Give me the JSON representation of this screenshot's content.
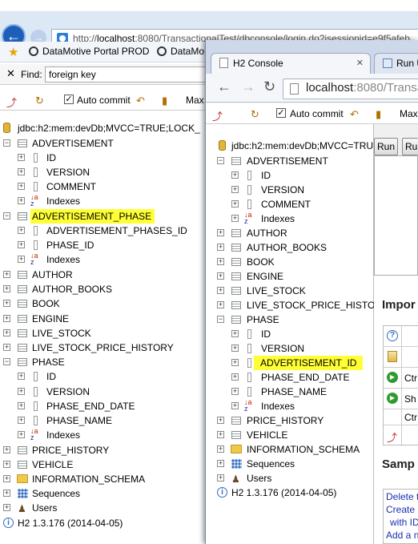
{
  "ie": {
    "url_prefix": "http://",
    "url_host": "localhost",
    "url_rest": ":8080/TransactionalTest/dbconsole/login.do?jsessionid=e9f5afeb",
    "favorites": [
      "DataMotive Portal PROD",
      "DataMo"
    ],
    "find_label": "Find:",
    "find_value": "foreign key",
    "auto_commit": "Auto commit",
    "max_label": "Max",
    "jdbc": "jdbc:h2:mem:devDb;MVCC=TRUE;LOCK_",
    "tree": {
      "advertisement": "ADVERTISEMENT",
      "id": "ID",
      "version": "VERSION",
      "comment": "COMMENT",
      "indexes": "Indexes",
      "advertisement_phase": "ADVERTISEMENT_PHASE",
      "advertisement_phases_id": "ADVERTISEMENT_PHASES_ID",
      "phase_id": "PHASE_ID",
      "author": "AUTHOR",
      "author_books": "AUTHOR_BOOKS",
      "book": "BOOK",
      "engine": "ENGINE",
      "live_stock": "LIVE_STOCK",
      "live_stock_price_history": "LIVE_STOCK_PRICE_HISTORY",
      "phase": "PHASE",
      "phase_end_date": "PHASE_END_DATE",
      "phase_name": "PHASE_NAME",
      "price_history": "PRICE_HISTORY",
      "vehicle": "VEHICLE",
      "information_schema": "INFORMATION_SCHEMA",
      "sequences": "Sequences",
      "users": "Users",
      "version_info": "H2 1.3.176 (2014-04-05)"
    }
  },
  "chrome": {
    "tab1": "H2 Console",
    "tab2": "Run U",
    "url_host": "localhost",
    "url_rest": ":8080/Transa",
    "auto_commit": "Auto commit",
    "max_label": "Max",
    "jdbc": "jdbc:h2:mem:devDb;MVCC=TRU",
    "run1": "Run",
    "run2": "Ru",
    "important": "Impor",
    "samples": "Samp",
    "help_rows": [
      "Ctr",
      "Sh",
      "Ctr"
    ],
    "sample_links": [
      "Delete t",
      "Create",
      "with ID",
      "Add a n"
    ],
    "tree": {
      "advertisement": "ADVERTISEMENT",
      "id": "ID",
      "version": "VERSION",
      "comment": "COMMENT",
      "indexes": "Indexes",
      "author": "AUTHOR",
      "author_books": "AUTHOR_BOOKS",
      "book": "BOOK",
      "engine": "ENGINE",
      "live_stock": "LIVE_STOCK",
      "live_stock_price_history": "LIVE_STOCK_PRICE_HISTO",
      "phase": "PHASE",
      "advertisement_id": "ADVERTISEMENT_ID",
      "phase_end_date": "PHASE_END_DATE",
      "phase_name": "PHASE_NAME",
      "price_history": "PRICE_HISTORY",
      "vehicle": "VEHICLE",
      "information_schema": "INFORMATION_SCHEMA",
      "sequences": "Sequences",
      "users": "Users",
      "version_info": "H2 1.3.176 (2014-04-05)"
    }
  },
  "colors": {
    "highlight": "#ffff36",
    "ie_chrome": "#dde8f5",
    "link": "#1a2fb0"
  }
}
